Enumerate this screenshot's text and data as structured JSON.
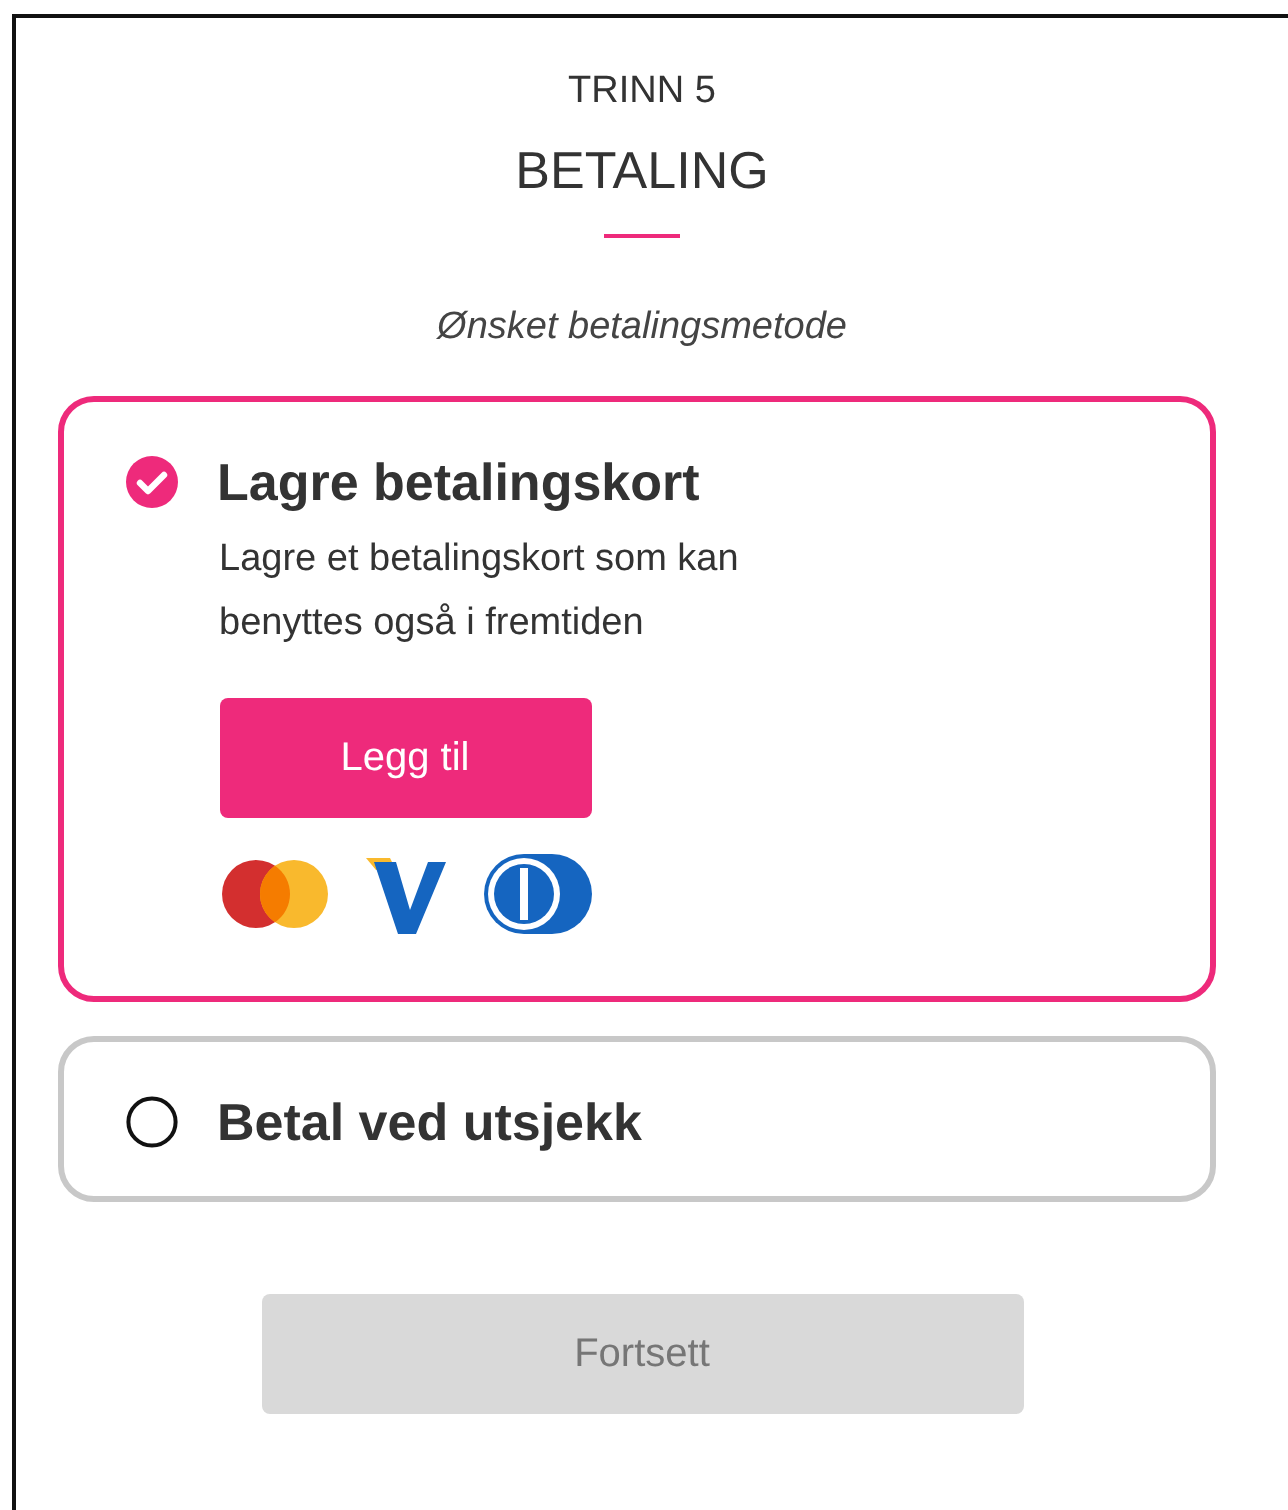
{
  "step": "TRINN 5",
  "title": "BETALING",
  "subtitle": "Ønsket betalingsmetode",
  "options": [
    {
      "label": "Lagre betalingskort",
      "selected": true,
      "description": "Lagre et betalingskort som kan benyttes også i fremtiden",
      "button": "Legg til"
    },
    {
      "label": "Betal ved utsjekk",
      "selected": false
    }
  ],
  "continue": {
    "label": "Fortsett",
    "disabled": true
  }
}
